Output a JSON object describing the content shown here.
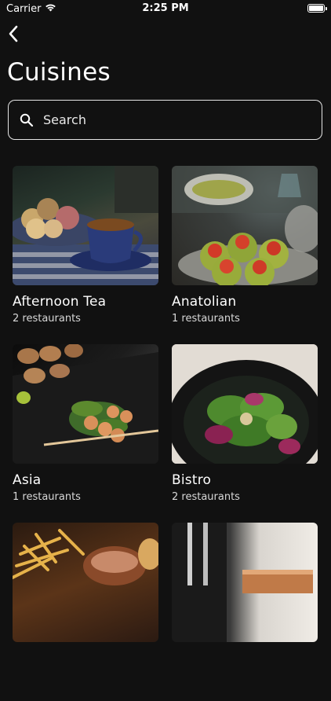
{
  "status": {
    "carrier": "Carrier",
    "time": "2:25 PM",
    "battery_level": 0.9
  },
  "header": {
    "title": "Cuisines"
  },
  "search": {
    "placeholder": "Search"
  },
  "colors": {
    "background": "#111111",
    "text": "#ffffff",
    "border": "#e5e5e5"
  },
  "cuisines": [
    {
      "name": "Afternoon Tea",
      "count": "2 restaurants",
      "image": "afternoon-tea-photo"
    },
    {
      "name": "Anatolian",
      "count": "1 restaurants",
      "image": "anatolian-photo"
    },
    {
      "name": "Asia",
      "count": "1 restaurants",
      "image": "asia-photo"
    },
    {
      "name": "Bistro",
      "count": "2 restaurants",
      "image": "bistro-photo"
    },
    {
      "name": "",
      "count": "",
      "image": "fries-photo"
    },
    {
      "name": "",
      "count": "",
      "image": "dessert-photo"
    }
  ]
}
